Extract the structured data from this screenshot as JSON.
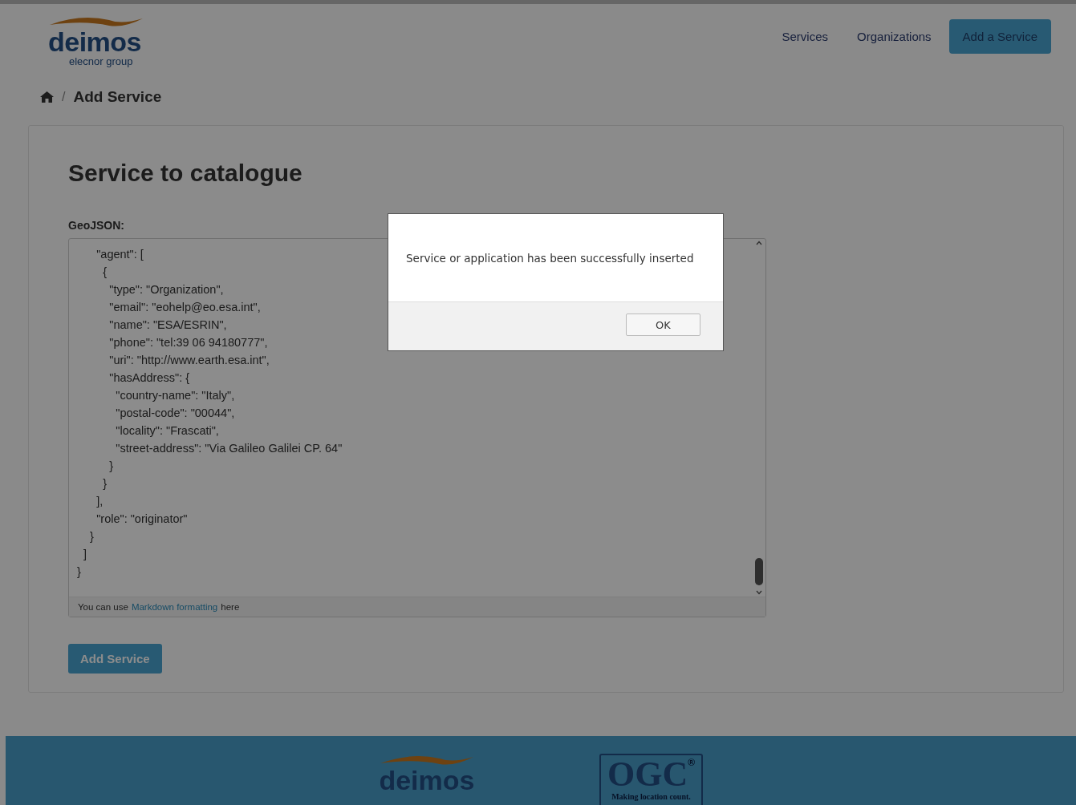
{
  "header": {
    "logo": {
      "name": "deimos",
      "tagline": "elecnor group"
    },
    "nav": [
      {
        "label": "Services",
        "kind": "link"
      },
      {
        "label": "Organizations",
        "kind": "link"
      },
      {
        "label": "Add a Service",
        "kind": "button"
      }
    ]
  },
  "breadcrumb": {
    "separator": "/",
    "current": "Add Service"
  },
  "form": {
    "title": "Service to catalogue",
    "field_label": "GeoJSON:",
    "editor_lines": [
      "      \"agent\": [",
      "        {",
      "          \"type\": \"Organization\",",
      "          \"email\": \"eohelp@eo.esa.int\",",
      "          \"name\": \"ESA/ESRIN\",",
      "          \"phone\": \"tel:39 06 94180777\",",
      "          \"uri\": \"http://www.earth.esa.int\",",
      "          \"hasAddress\": {",
      "            \"country-name\": \"Italy\",",
      "            \"postal-code\": \"00044\",",
      "            \"locality\": \"Frascati\",",
      "            \"street-address\": \"Via Galileo Galilei CP. 64\"",
      "          }",
      "        }",
      "      ],",
      "      \"role\": \"originator\"",
      "    }",
      "  ]",
      "}"
    ],
    "hint": {
      "before": "You can use",
      "link": "Markdown formatting",
      "after": "here"
    },
    "submit": "Add Service"
  },
  "footer": {
    "logos": [
      {
        "kind": "deimos",
        "text": "deimos"
      },
      {
        "kind": "ogc",
        "text": "OGC",
        "mark": "®",
        "tagline": "Making location count."
      }
    ]
  },
  "dialog": {
    "message": "Service or application has been successfully inserted",
    "button": "OK"
  }
}
